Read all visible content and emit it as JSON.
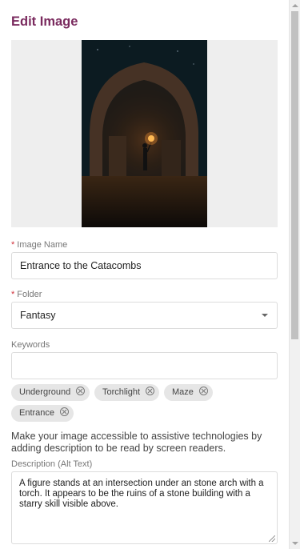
{
  "header": {
    "title": "Edit Image"
  },
  "image": {
    "alt": "Dark stone arch with a person holding a torch"
  },
  "image_name": {
    "label": "Image Name",
    "required_mark": "*",
    "value": "Entrance to the Catacombs"
  },
  "folder": {
    "label": "Folder",
    "required_mark": "*",
    "value": "Fantasy"
  },
  "keywords": {
    "label": "Keywords",
    "value": "",
    "tags": [
      "Underground",
      "Torchlight",
      "Maze",
      "Entrance"
    ]
  },
  "accessibility": {
    "help_text": "Make your image accessible to assistive technologies by adding description to be read by screen readers.",
    "description_label": "Description (Alt Text)",
    "description_value": "A figure stands at an intersection under an stone arch with a torch. It appears to be the ruins of a stone building with a starry skill visible above."
  },
  "colors": {
    "title": "#7a2a5e",
    "required": "#d0313b"
  }
}
